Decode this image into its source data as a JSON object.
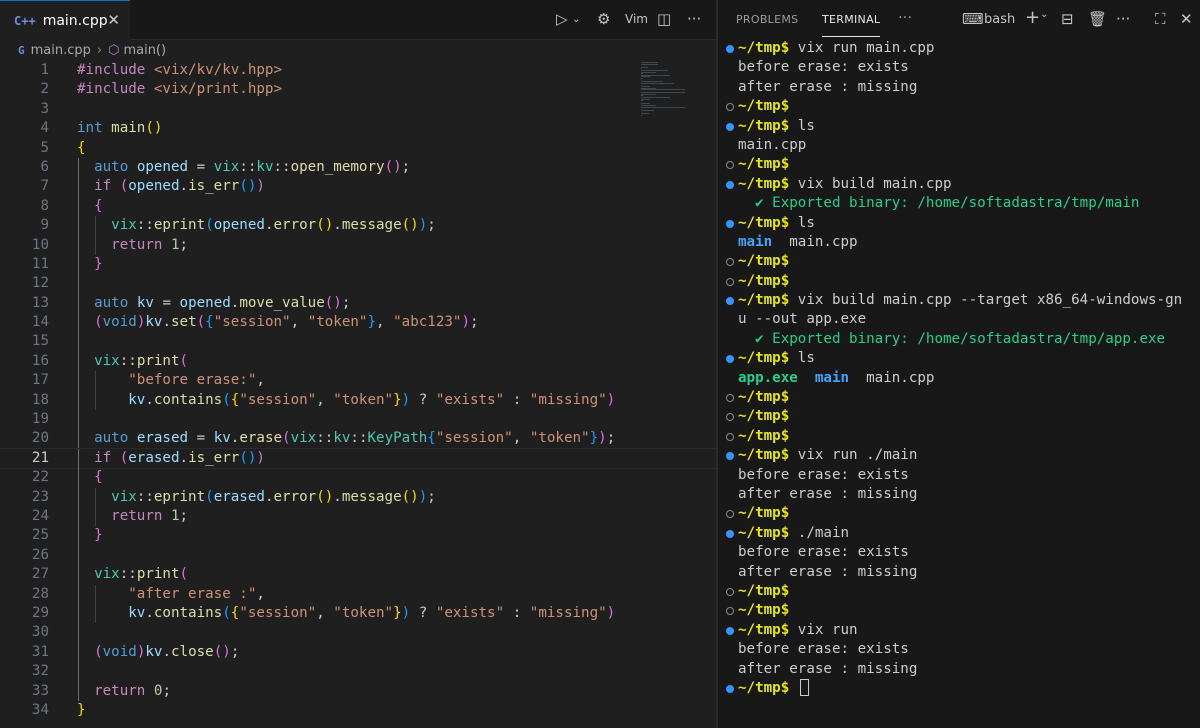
{
  "editor": {
    "tab": {
      "icon": "C++",
      "label": "main.cpp",
      "close": "✕"
    },
    "actions": {
      "vim_label": "Vim"
    },
    "breadcrumb": {
      "file": "main.cpp",
      "symbol": "main()"
    },
    "code": [
      {
        "n": "1",
        "t": [
          [
            "pp",
            "#include "
          ],
          [
            "st",
            "<vix/kv/kv.hpp>"
          ]
        ]
      },
      {
        "n": "2",
        "t": [
          [
            "pp",
            "#include "
          ],
          [
            "st",
            "<vix/print.hpp>"
          ]
        ]
      },
      {
        "n": "3",
        "t": []
      },
      {
        "n": "4",
        "t": [
          [
            "kw",
            "int "
          ],
          [
            "fn",
            "main"
          ],
          [
            "b1",
            "()"
          ]
        ]
      },
      {
        "n": "5",
        "t": [
          [
            "b1",
            "{"
          ]
        ]
      },
      {
        "n": "6",
        "t": [
          [
            "pl",
            "  "
          ],
          [
            "kw",
            "auto "
          ],
          [
            "vr",
            "opened"
          ],
          [
            "pl",
            " = "
          ],
          [
            "ty",
            "vix"
          ],
          [
            "pl",
            "::"
          ],
          [
            "ty",
            "kv"
          ],
          [
            "pl",
            "::"
          ],
          [
            "fn",
            "open_memory"
          ],
          [
            "b2",
            "()"
          ],
          [
            "pl",
            ";"
          ]
        ]
      },
      {
        "n": "7",
        "t": [
          [
            "pl",
            "  "
          ],
          [
            "pp",
            "if "
          ],
          [
            "b2",
            "("
          ],
          [
            "vr",
            "opened"
          ],
          [
            "pl",
            "."
          ],
          [
            "fn",
            "is_err"
          ],
          [
            "b3",
            "()"
          ],
          [
            "b2",
            ")"
          ]
        ]
      },
      {
        "n": "8",
        "t": [
          [
            "pl",
            "  "
          ],
          [
            "b2",
            "{"
          ]
        ]
      },
      {
        "n": "9",
        "t": [
          [
            "pl",
            "    "
          ],
          [
            "ty",
            "vix"
          ],
          [
            "pl",
            "::"
          ],
          [
            "fn",
            "eprint"
          ],
          [
            "b3",
            "("
          ],
          [
            "vr",
            "opened"
          ],
          [
            "pl",
            "."
          ],
          [
            "fn",
            "error"
          ],
          [
            "b1",
            "()"
          ],
          [
            "pl",
            "."
          ],
          [
            "fn",
            "message"
          ],
          [
            "b1",
            "()"
          ],
          [
            "b3",
            ")"
          ],
          [
            "pl",
            ";"
          ]
        ]
      },
      {
        "n": "10",
        "t": [
          [
            "pl",
            "    "
          ],
          [
            "pp",
            "return "
          ],
          [
            "nm",
            "1"
          ],
          [
            "pl",
            ";"
          ]
        ]
      },
      {
        "n": "11",
        "t": [
          [
            "pl",
            "  "
          ],
          [
            "b2",
            "}"
          ]
        ]
      },
      {
        "n": "12",
        "t": []
      },
      {
        "n": "13",
        "t": [
          [
            "pl",
            "  "
          ],
          [
            "kw",
            "auto "
          ],
          [
            "vr",
            "kv"
          ],
          [
            "pl",
            " = "
          ],
          [
            "vr",
            "opened"
          ],
          [
            "pl",
            "."
          ],
          [
            "fn",
            "move_value"
          ],
          [
            "b2",
            "()"
          ],
          [
            "pl",
            ";"
          ]
        ]
      },
      {
        "n": "14",
        "t": [
          [
            "pl",
            "  "
          ],
          [
            "b2",
            "("
          ],
          [
            "kw",
            "void"
          ],
          [
            "b2",
            ")"
          ],
          [
            "vr",
            "kv"
          ],
          [
            "pl",
            "."
          ],
          [
            "fn",
            "set"
          ],
          [
            "b2",
            "("
          ],
          [
            "b3",
            "{"
          ],
          [
            "st",
            "\"session\""
          ],
          [
            "pl",
            ", "
          ],
          [
            "st",
            "\"token\""
          ],
          [
            "b3",
            "}"
          ],
          [
            "pl",
            ", "
          ],
          [
            "st",
            "\"abc123\""
          ],
          [
            "b2",
            ")"
          ],
          [
            "pl",
            ";"
          ]
        ]
      },
      {
        "n": "15",
        "t": []
      },
      {
        "n": "16",
        "t": [
          [
            "pl",
            "  "
          ],
          [
            "ty",
            "vix"
          ],
          [
            "pl",
            "::"
          ],
          [
            "fn",
            "print"
          ],
          [
            "b2",
            "("
          ]
        ]
      },
      {
        "n": "17",
        "t": [
          [
            "pl",
            "      "
          ],
          [
            "st",
            "\"before erase:\""
          ],
          [
            "pl",
            ","
          ]
        ]
      },
      {
        "n": "18",
        "t": [
          [
            "pl",
            "      "
          ],
          [
            "vr",
            "kv"
          ],
          [
            "pl",
            "."
          ],
          [
            "fn",
            "contains"
          ],
          [
            "b3",
            "("
          ],
          [
            "b1",
            "{"
          ],
          [
            "st",
            "\"session\""
          ],
          [
            "pl",
            ", "
          ],
          [
            "st",
            "\"token\""
          ],
          [
            "b1",
            "}"
          ],
          [
            "b3",
            ")"
          ],
          [
            "pl",
            " ? "
          ],
          [
            "st",
            "\"exists\""
          ],
          [
            "pl",
            " : "
          ],
          [
            "st",
            "\"missing\""
          ],
          [
            "b2",
            ")"
          ]
        ]
      },
      {
        "n": "19",
        "t": []
      },
      {
        "n": "20",
        "t": [
          [
            "pl",
            "  "
          ],
          [
            "kw",
            "auto "
          ],
          [
            "vr",
            "erased"
          ],
          [
            "pl",
            " = "
          ],
          [
            "vr",
            "kv"
          ],
          [
            "pl",
            "."
          ],
          [
            "fn",
            "erase"
          ],
          [
            "b2",
            "("
          ],
          [
            "ty",
            "vix"
          ],
          [
            "pl",
            "::"
          ],
          [
            "ty",
            "kv"
          ],
          [
            "pl",
            "::"
          ],
          [
            "ty",
            "KeyPath"
          ],
          [
            "b3",
            "{"
          ],
          [
            "st",
            "\"session\""
          ],
          [
            "pl",
            ", "
          ],
          [
            "st",
            "\"token\""
          ],
          [
            "b3",
            "}"
          ],
          [
            "b2",
            ")"
          ],
          [
            "pl",
            ";"
          ]
        ]
      },
      {
        "n": "21",
        "t": [
          [
            "pl",
            "  "
          ],
          [
            "pp",
            "if "
          ],
          [
            "b2",
            "("
          ],
          [
            "vr",
            "erased"
          ],
          [
            "pl",
            "."
          ],
          [
            "fn",
            "is_err"
          ],
          [
            "b3",
            "()"
          ],
          [
            "b2",
            ")"
          ]
        ]
      },
      {
        "n": "22",
        "t": [
          [
            "pl",
            "  "
          ],
          [
            "b2",
            "{"
          ]
        ]
      },
      {
        "n": "23",
        "t": [
          [
            "pl",
            "    "
          ],
          [
            "ty",
            "vix"
          ],
          [
            "pl",
            "::"
          ],
          [
            "fn",
            "eprint"
          ],
          [
            "b3",
            "("
          ],
          [
            "vr",
            "erased"
          ],
          [
            "pl",
            "."
          ],
          [
            "fn",
            "error"
          ],
          [
            "b1",
            "()"
          ],
          [
            "pl",
            "."
          ],
          [
            "fn",
            "message"
          ],
          [
            "b1",
            "()"
          ],
          [
            "b3",
            ")"
          ],
          [
            "pl",
            ";"
          ]
        ]
      },
      {
        "n": "24",
        "t": [
          [
            "pl",
            "    "
          ],
          [
            "pp",
            "return "
          ],
          [
            "nm",
            "1"
          ],
          [
            "pl",
            ";"
          ]
        ]
      },
      {
        "n": "25",
        "t": [
          [
            "pl",
            "  "
          ],
          [
            "b2",
            "}"
          ]
        ]
      },
      {
        "n": "26",
        "t": []
      },
      {
        "n": "27",
        "t": [
          [
            "pl",
            "  "
          ],
          [
            "ty",
            "vix"
          ],
          [
            "pl",
            "::"
          ],
          [
            "fn",
            "print"
          ],
          [
            "b2",
            "("
          ]
        ]
      },
      {
        "n": "28",
        "t": [
          [
            "pl",
            "      "
          ],
          [
            "st",
            "\"after erase :\""
          ],
          [
            "pl",
            ","
          ]
        ]
      },
      {
        "n": "29",
        "t": [
          [
            "pl",
            "      "
          ],
          [
            "vr",
            "kv"
          ],
          [
            "pl",
            "."
          ],
          [
            "fn",
            "contains"
          ],
          [
            "b3",
            "("
          ],
          [
            "b1",
            "{"
          ],
          [
            "st",
            "\"session\""
          ],
          [
            "pl",
            ", "
          ],
          [
            "st",
            "\"token\""
          ],
          [
            "b1",
            "}"
          ],
          [
            "b3",
            ")"
          ],
          [
            "pl",
            " ? "
          ],
          [
            "st",
            "\"exists\""
          ],
          [
            "pl",
            " : "
          ],
          [
            "st",
            "\"missing\""
          ],
          [
            "b2",
            ")"
          ]
        ]
      },
      {
        "n": "30",
        "t": []
      },
      {
        "n": "31",
        "t": [
          [
            "pl",
            "  "
          ],
          [
            "b2",
            "("
          ],
          [
            "kw",
            "void"
          ],
          [
            "b2",
            ")"
          ],
          [
            "vr",
            "kv"
          ],
          [
            "pl",
            "."
          ],
          [
            "fn",
            "close"
          ],
          [
            "b2",
            "()"
          ],
          [
            "pl",
            ";"
          ]
        ]
      },
      {
        "n": "32",
        "t": []
      },
      {
        "n": "33",
        "t": [
          [
            "pl",
            "  "
          ],
          [
            "pp",
            "return "
          ],
          [
            "nm",
            "0"
          ],
          [
            "pl",
            ";"
          ]
        ]
      },
      {
        "n": "34",
        "t": [
          [
            "b1",
            "}"
          ]
        ]
      }
    ]
  },
  "panel": {
    "tabs": {
      "problems": "PROBLEMS",
      "terminal": "TERMINAL",
      "more": "···"
    },
    "shell_label": "bash",
    "terminal": [
      {
        "d": "filled",
        "p": "~/tmp$",
        "c": " vix run main.cpp"
      },
      {
        "o": "before erase: exists"
      },
      {
        "o": "after erase : missing"
      },
      {
        "d": "hollow",
        "p": "~/tmp$",
        "c": ""
      },
      {
        "d": "filled",
        "p": "~/tmp$",
        "c": " ls"
      },
      {
        "o": "main.cpp"
      },
      {
        "d": "hollow",
        "p": "~/tmp$",
        "c": ""
      },
      {
        "d": "filled",
        "p": "~/tmp$",
        "c": " vix build main.cpp"
      },
      {
        "ok": "  ✔ Exported binary: /home/softadastra/tmp/main"
      },
      {
        "d": "filled",
        "p": "~/tmp$",
        "c": " ls"
      },
      {
        "ls": [
          [
            "dirname",
            "main"
          ],
          [
            "pl",
            "  main.cpp"
          ]
        ]
      },
      {
        "d": "hollow",
        "p": "~/tmp$",
        "c": ""
      },
      {
        "d": "hollow",
        "p": "~/tmp$",
        "c": ""
      },
      {
        "d": "filled",
        "p": "~/tmp$",
        "c": " vix build main.cpp --target x86_64-windows-gn"
      },
      {
        "o": "u --out app.exe"
      },
      {
        "ok": "  ✔ Exported binary: /home/softadastra/tmp/app.exe"
      },
      {
        "d": "filled",
        "p": "~/tmp$",
        "c": " ls"
      },
      {
        "ls": [
          [
            "exe",
            "app.exe"
          ],
          [
            "pl",
            "  "
          ],
          [
            "dirname",
            "main"
          ],
          [
            "pl",
            "  main.cpp"
          ]
        ]
      },
      {
        "d": "hollow",
        "p": "~/tmp$",
        "c": ""
      },
      {
        "d": "hollow",
        "p": "~/tmp$",
        "c": ""
      },
      {
        "d": "hollow",
        "p": "~/tmp$",
        "c": ""
      },
      {
        "d": "filled",
        "p": "~/tmp$",
        "c": " vix run ./main"
      },
      {
        "o": "before erase: exists"
      },
      {
        "o": "after erase : missing"
      },
      {
        "d": "hollow",
        "p": "~/tmp$",
        "c": ""
      },
      {
        "d": "filled",
        "p": "~/tmp$",
        "c": " ./main"
      },
      {
        "o": "before erase: exists"
      },
      {
        "o": "after erase : missing"
      },
      {
        "d": "hollow",
        "p": "~/tmp$",
        "c": ""
      },
      {
        "d": "hollow",
        "p": "~/tmp$",
        "c": ""
      },
      {
        "d": "filled",
        "p": "~/tmp$",
        "c": " vix run"
      },
      {
        "o": "before erase: exists"
      },
      {
        "o": "after erase : missing"
      },
      {
        "d": "filled",
        "p": "~/tmp$",
        "c": " ",
        "cursor": true
      }
    ]
  }
}
